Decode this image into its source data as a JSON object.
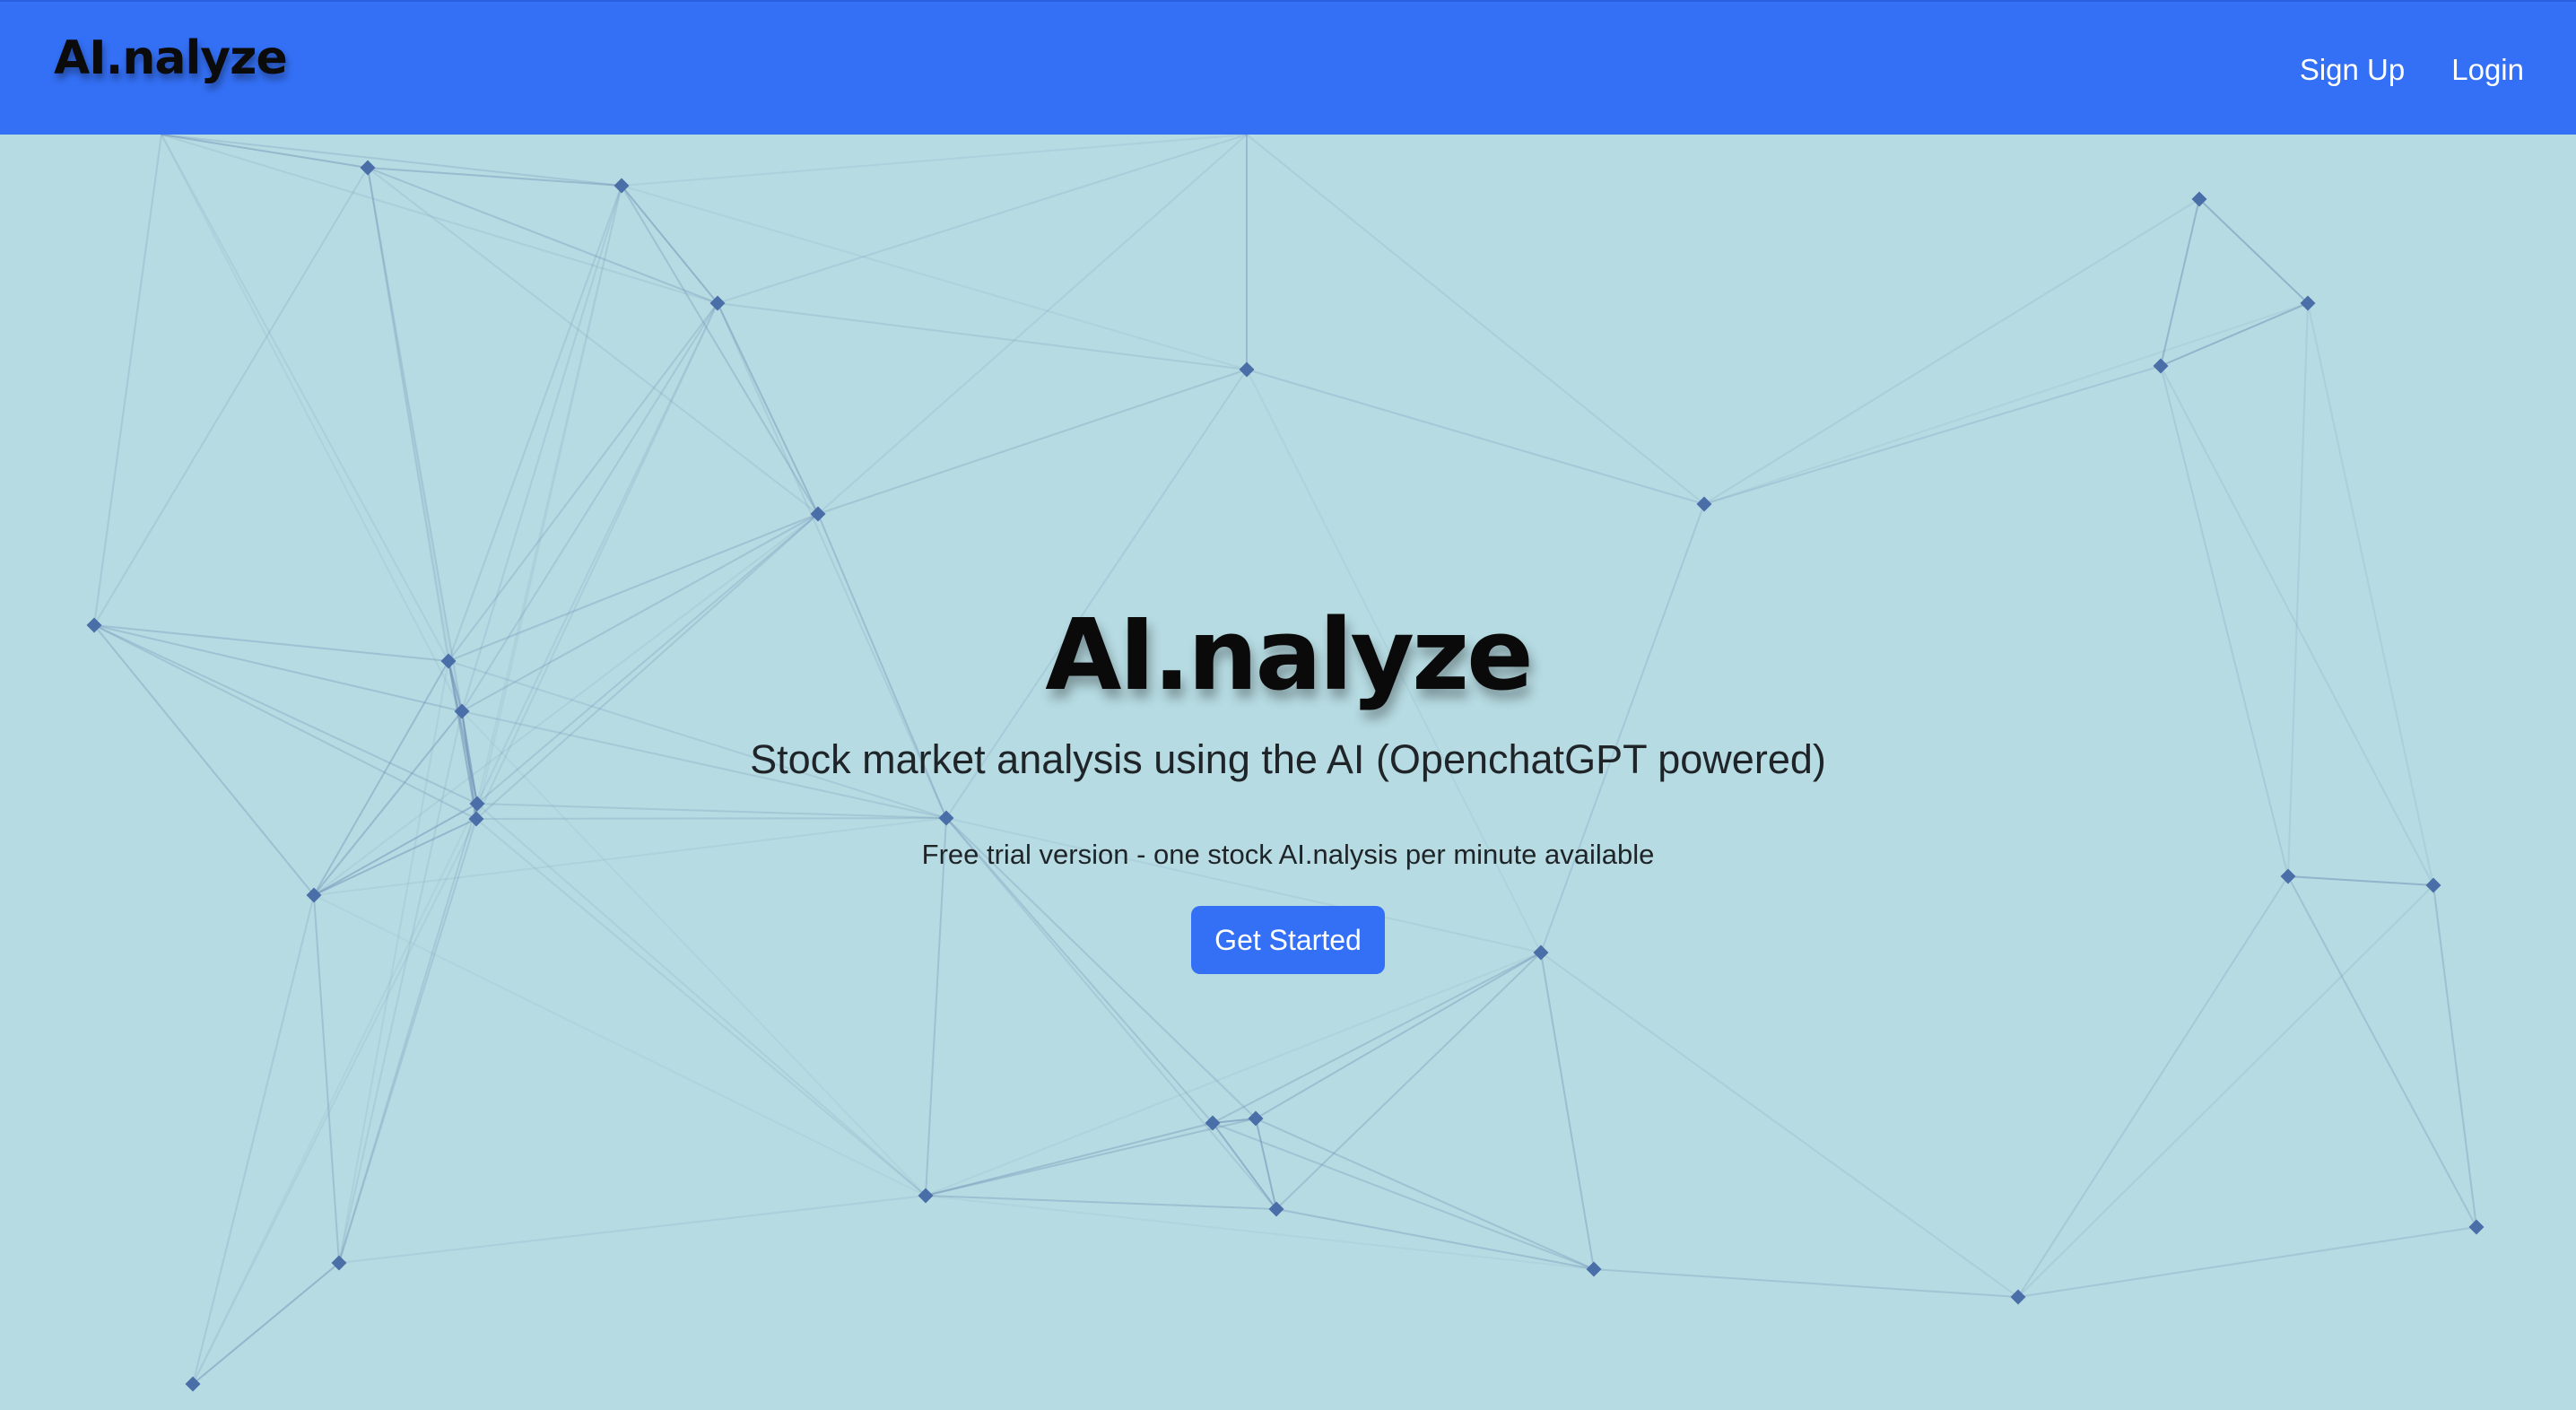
{
  "nav": {
    "brand": "AI.nalyze",
    "signup": "Sign Up",
    "login": "Login"
  },
  "hero": {
    "title": "AI.nalyze",
    "subtitle": "Stock market analysis using the AI (OpenchatGPT powered)",
    "note": "Free trial version - one stock AI.nalysis per minute available",
    "cta": "Get Started"
  },
  "colors": {
    "navbar": "#3470f5",
    "background": "#b6dbe2",
    "node": "#4a6fa8",
    "edge": "#6f8fb5",
    "button": "#3470f5"
  }
}
